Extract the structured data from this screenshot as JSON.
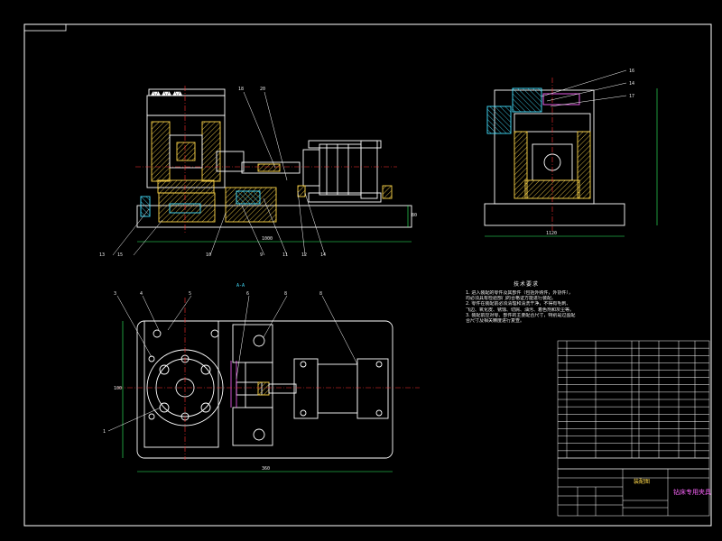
{
  "drawing": {
    "title": "钻床专用夹具",
    "sheet_name": "装配图",
    "tech_title": "技术要求",
    "tech_notes": [
      "1. 进入装配的零件及其部件（包括外购件，外协件），",
      "均必须具有检验部门的合格证方能进行装配。",
      "2. 零件在装配前必须清理和清洗干净，不得有毛刺、",
      "飞边、氧化皮、锈蚀、切屑、油污、着色剂和灰尘等。",
      "3. 装配前应对零、部件的主要配合尺寸，特别是过盈配",
      "合尺寸及相关精度进行复查。"
    ]
  },
  "front_view": {
    "callouts_top": [
      "18",
      "20"
    ],
    "callouts_bottom": [
      "13",
      "15",
      "10",
      "9",
      "11",
      "12",
      "14"
    ],
    "dim_width": "1000",
    "dim_height": "80"
  },
  "side_view": {
    "callouts": [
      "16",
      "14",
      "17"
    ],
    "dim_width": "1120"
  },
  "plan_view": {
    "callouts": [
      "3",
      "4",
      "5",
      "6",
      "8",
      "8",
      "1"
    ],
    "section_mark": "A-A",
    "dim_width": "360",
    "dim_height": "100"
  },
  "bom": {
    "rows": 16
  },
  "colors": {
    "outline": "#ffffff",
    "part": "#f2f2f2",
    "hatch": "#ffd84a",
    "center": "#ff3030",
    "dimension": "#33ff66",
    "highlight": "#ff66ff",
    "cyan": "#44e0ff"
  }
}
